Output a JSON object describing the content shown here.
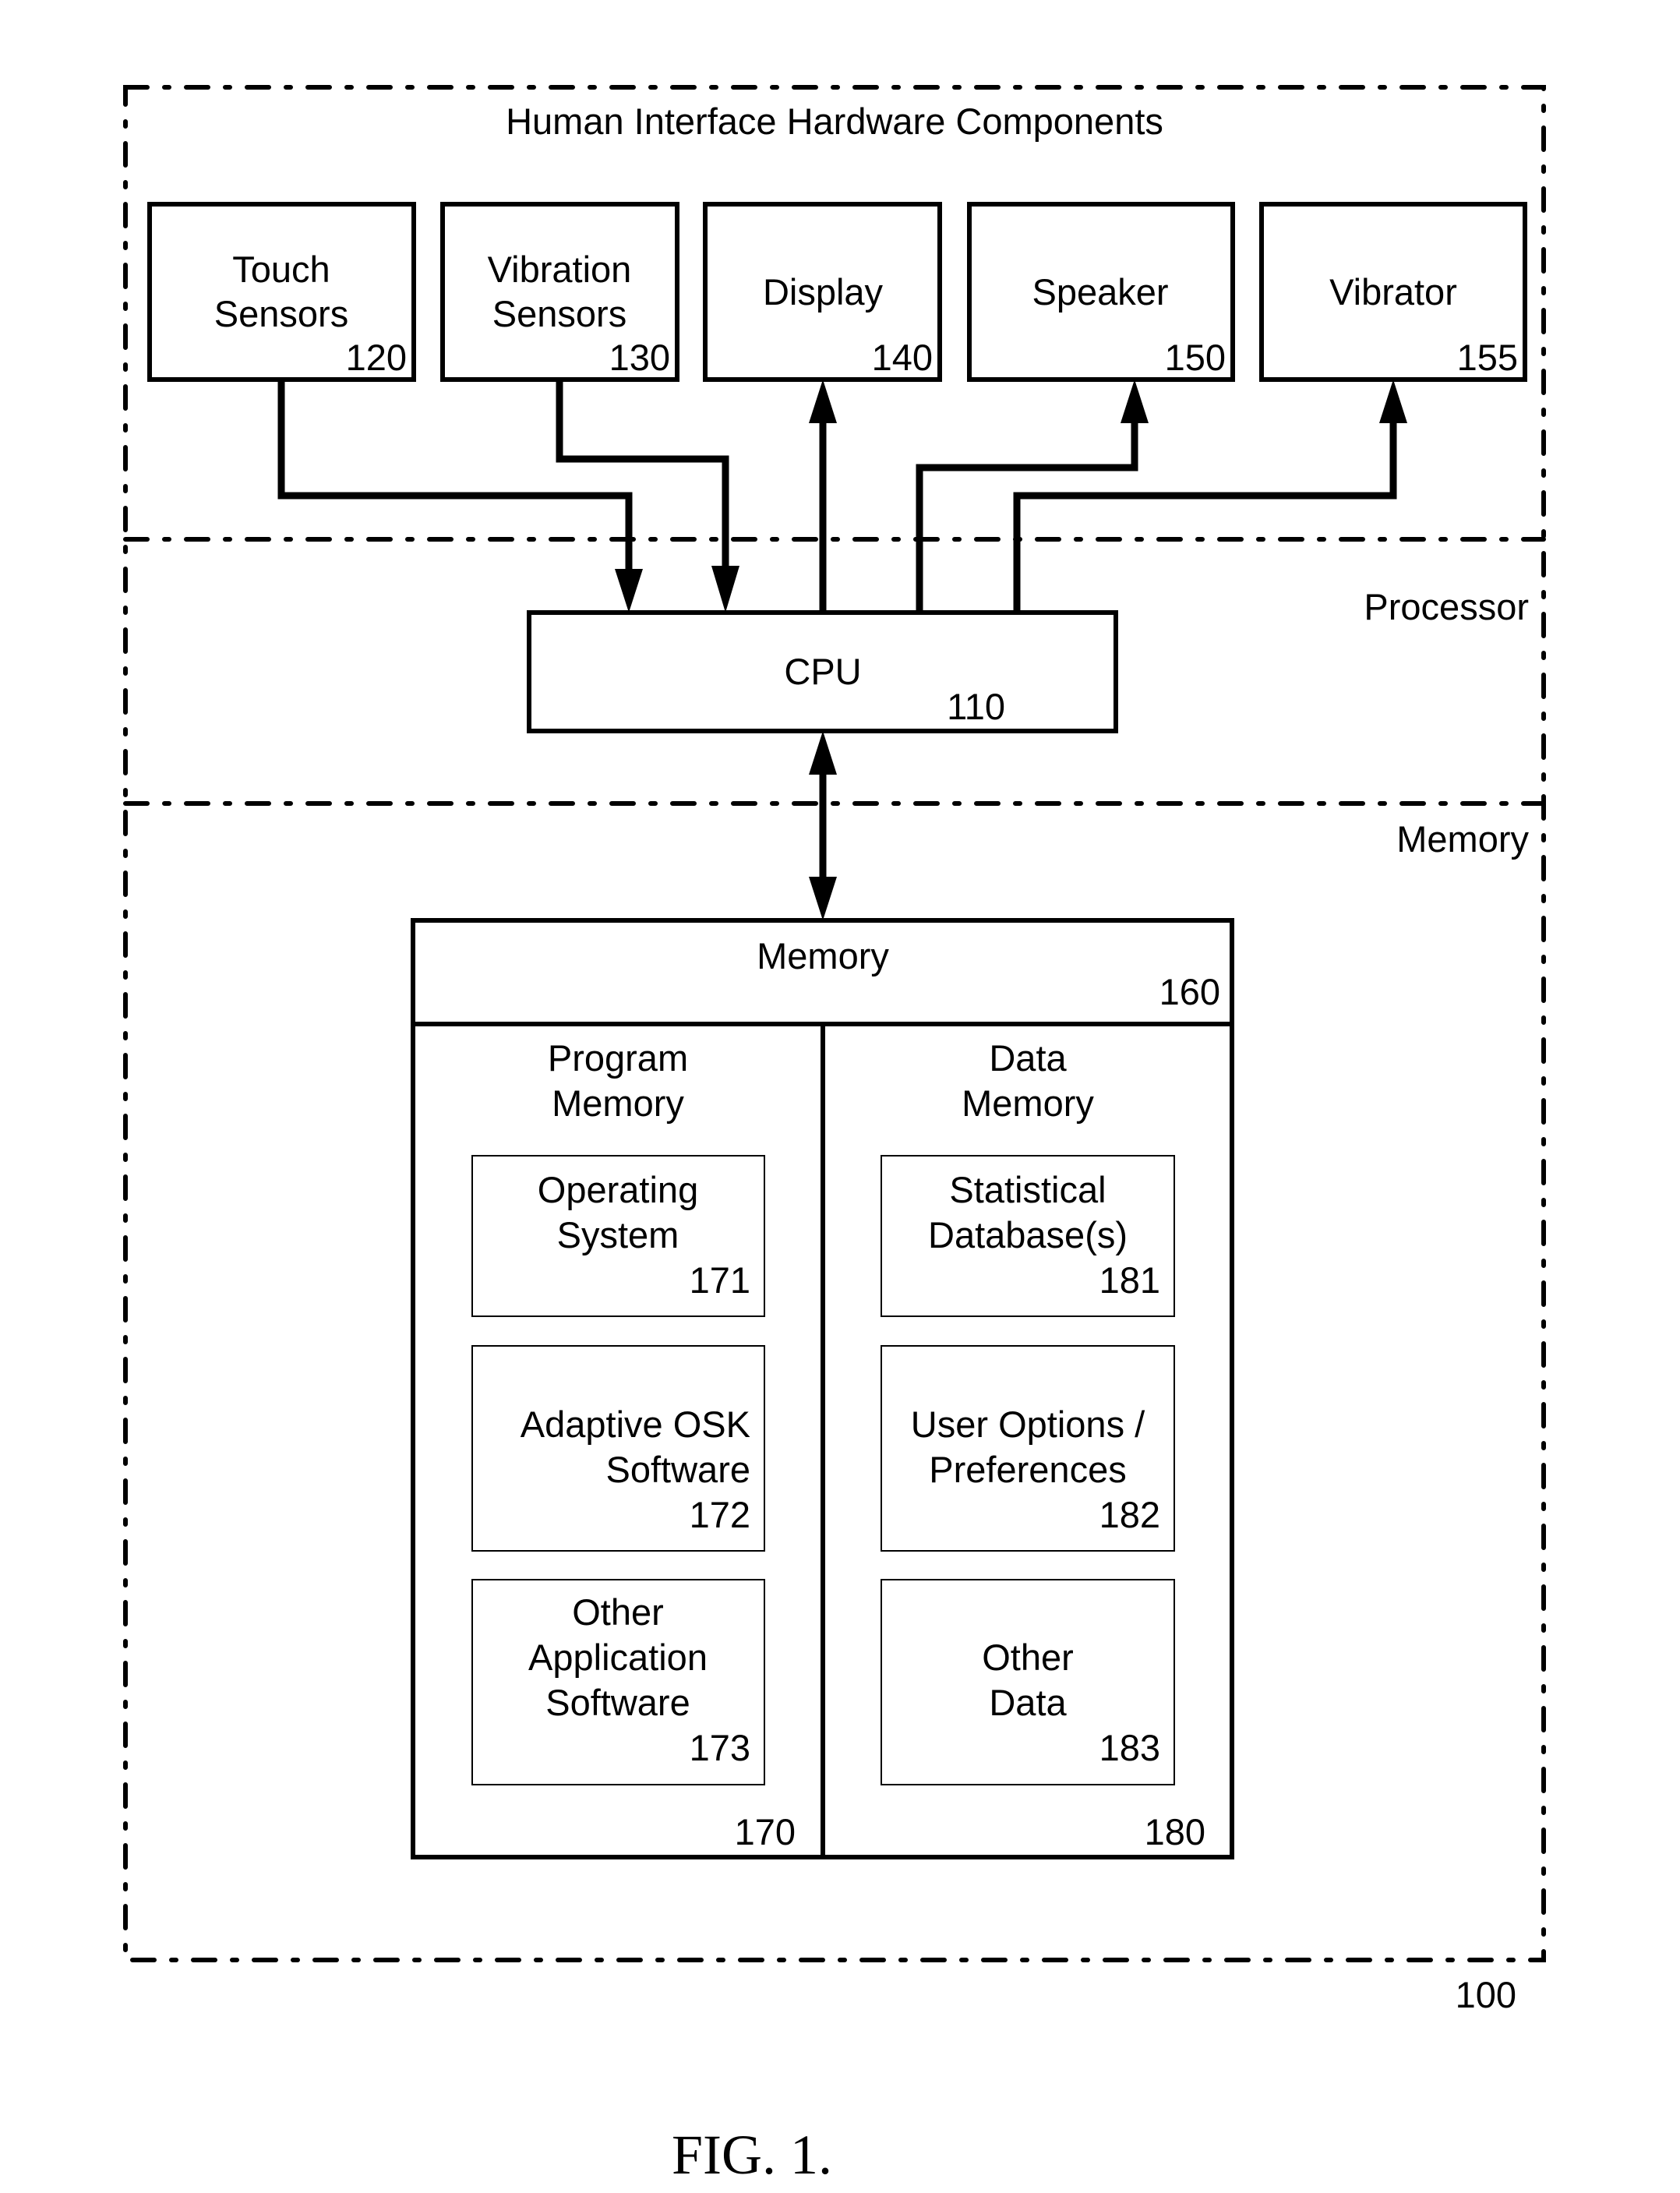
{
  "figure": {
    "caption": "FIG. 1.",
    "system_ref": "100"
  },
  "regions": {
    "hardware": {
      "label": "Human Interface Hardware Components"
    },
    "processor": {
      "label": "Processor"
    },
    "memory": {
      "label": "Memory"
    }
  },
  "hardware_components": [
    {
      "lines": [
        "Touch",
        "Sensors"
      ],
      "ref": "120",
      "direction": "to-cpu"
    },
    {
      "lines": [
        "Vibration",
        "Sensors"
      ],
      "ref": "130",
      "direction": "to-cpu"
    },
    {
      "lines": [
        "Display"
      ],
      "ref": "140",
      "direction": "from-cpu"
    },
    {
      "lines": [
        "Speaker"
      ],
      "ref": "150",
      "direction": "from-cpu"
    },
    {
      "lines": [
        "Vibrator"
      ],
      "ref": "155",
      "direction": "from-cpu"
    }
  ],
  "cpu": {
    "label": "CPU",
    "ref": "110"
  },
  "memory": {
    "label": "Memory",
    "ref": "160",
    "program_memory": {
      "lines": [
        "Program",
        "Memory"
      ],
      "ref": "170",
      "items": [
        {
          "lines": [
            "Operating",
            "System"
          ],
          "ref": "171"
        },
        {
          "lines": [
            "Adaptive OSK",
            "Software"
          ],
          "ref": "172"
        },
        {
          "lines": [
            "Other",
            "Application",
            "Software"
          ],
          "ref": "173"
        }
      ]
    },
    "data_memory": {
      "lines": [
        "Data",
        "Memory"
      ],
      "ref": "180",
      "items": [
        {
          "lines": [
            "Statistical",
            "Database(s)"
          ],
          "ref": "181"
        },
        {
          "lines": [
            "User Options /",
            "Preferences"
          ],
          "ref": "182"
        },
        {
          "lines": [
            "Other",
            "Data"
          ],
          "ref": "183"
        }
      ]
    }
  }
}
